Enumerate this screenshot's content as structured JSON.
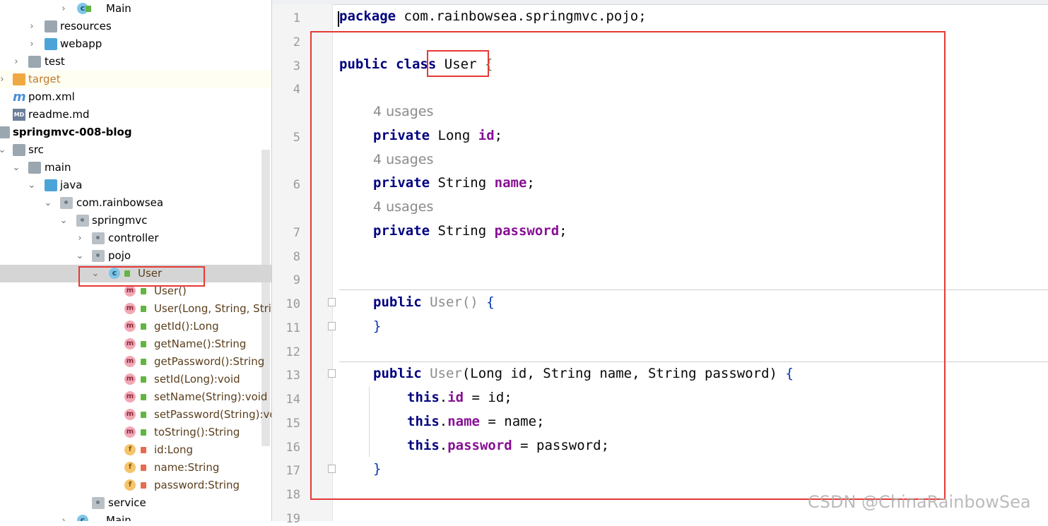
{
  "tree": {
    "rows": [
      {
        "label": "Main",
        "icon": "class-icon"
      },
      {
        "label": "resources",
        "icon": "resources-folder-icon"
      },
      {
        "label": "webapp",
        "icon": "web-folder-icon"
      },
      {
        "label": "test",
        "icon": "folder-icon"
      },
      {
        "label": "target",
        "icon": "excluded-folder-icon"
      },
      {
        "label": "pom.xml",
        "icon": "maven-icon"
      },
      {
        "label": "readme.md",
        "icon": "markdown-icon"
      },
      {
        "label": "springmvc-008-blog",
        "icon": "module-icon"
      },
      {
        "label": "src",
        "icon": "folder-icon"
      },
      {
        "label": "main",
        "icon": "folder-icon"
      },
      {
        "label": "java",
        "icon": "source-folder-icon"
      },
      {
        "label": "com.rainbowsea",
        "icon": "package-icon"
      },
      {
        "label": "springmvc",
        "icon": "package-icon"
      },
      {
        "label": "controller",
        "icon": "package-icon"
      },
      {
        "label": "pojo",
        "icon": "package-icon"
      },
      {
        "label": "User",
        "icon": "class-icon"
      },
      {
        "label": "User()",
        "icon": "method-icon"
      },
      {
        "label": "User(Long, String, String)",
        "icon": "method-icon"
      },
      {
        "label": "getId():Long",
        "icon": "method-icon"
      },
      {
        "label": "getName():String",
        "icon": "method-icon"
      },
      {
        "label": "getPassword():String",
        "icon": "method-icon"
      },
      {
        "label": "setId(Long):void",
        "icon": "method-icon"
      },
      {
        "label": "setName(String):void",
        "icon": "method-icon"
      },
      {
        "label": "setPassword(String):void",
        "icon": "method-icon"
      },
      {
        "label": "toString():String",
        "icon": "method-icon"
      },
      {
        "label": "id:Long",
        "icon": "field-icon"
      },
      {
        "label": "name:String",
        "icon": "field-icon"
      },
      {
        "label": "password:String",
        "icon": "field-icon"
      },
      {
        "label": "service",
        "icon": "package-icon"
      },
      {
        "label": "Main",
        "icon": "class-icon"
      }
    ],
    "class_icon_letter": "c",
    "method_icon_letter": "m",
    "field_icon_letter": "f",
    "maven_icon_letter": "m",
    "md_icon_text": "MD"
  },
  "editor": {
    "line_numbers": [
      "1",
      "2",
      "3",
      "4",
      "5",
      "6",
      "7",
      "8",
      "9",
      "10",
      "11",
      "12",
      "13",
      "14",
      "15",
      "16",
      "17",
      "18",
      "19"
    ],
    "usages_hint": "4 usages",
    "tokens": {
      "package_kw": "package",
      "package_name": " com.rainbowsea.springmvc.pojo;",
      "public_kw": "public",
      "class_kw": "class",
      "class_name": "User",
      "open_brace": "{",
      "close_brace": "}",
      "private_kw": "private",
      "type_long": "Long",
      "type_string": "String",
      "field_id": "id",
      "field_name": "name",
      "field_password": "password",
      "semicolon": ";",
      "ctor_empty": "User()",
      "ctor_name": "User",
      "ctor_params": "(Long id, String name, String password)",
      "this_kw": "this",
      "assign_id": " = id;",
      "assign_name": " = name;",
      "assign_password": " = password;"
    }
  },
  "watermark": "CSDN @ChinaRainbowSea"
}
